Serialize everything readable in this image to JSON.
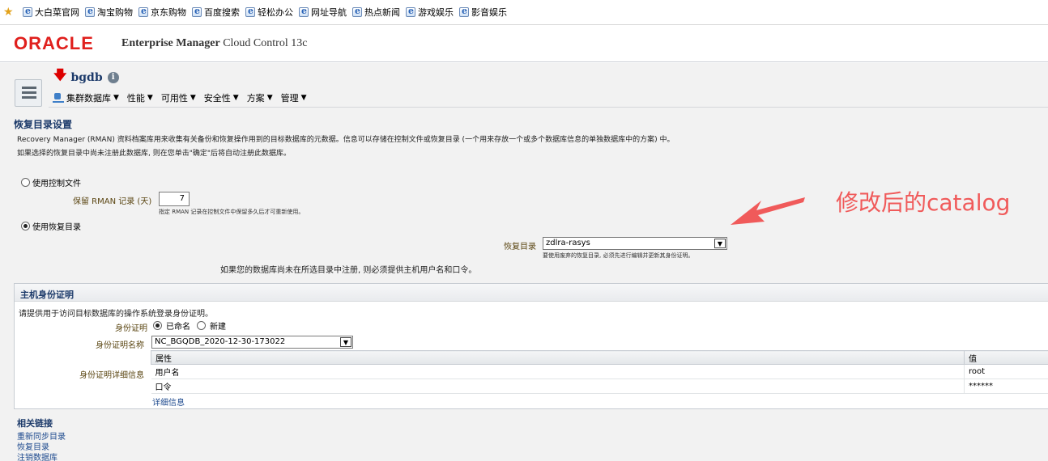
{
  "favorites": {
    "items": [
      {
        "label": "大白菜官网"
      },
      {
        "label": "淘宝购物"
      },
      {
        "label": "京东购物"
      },
      {
        "label": "百度搜索"
      },
      {
        "label": "轻松办公"
      },
      {
        "label": "网址导航"
      },
      {
        "label": "热点新闻"
      },
      {
        "label": "游戏娱乐"
      },
      {
        "label": "影音娱乐"
      }
    ]
  },
  "header": {
    "logo": "ORACLE",
    "product_bold": "Enterprise Manager",
    "product_rest": " Cloud Control 13c"
  },
  "target": {
    "name": "bgdb",
    "info_glyph": "i",
    "menus": [
      {
        "label": "集群数据库"
      },
      {
        "label": "性能"
      },
      {
        "label": "可用性"
      },
      {
        "label": "安全性"
      },
      {
        "label": "方案"
      },
      {
        "label": "管理"
      }
    ]
  },
  "recovery": {
    "title": "恢复目录设置",
    "description": "Recovery Manager (RMAN) 资料档案库用来收集有关备份和恢复操作用到的目标数据库的元数据。信息可以存储在控制文件或恢复目录 (一个用来存放一个或多个数据库信息的单独数据库中的方案) 中。",
    "description2": "如果选择的恢复目录中尚未注册此数据库, 则在您单击\"确定\"后将自动注册此数据库。",
    "option_control_file": "使用控制文件",
    "rman_label": "保留 RMAN 记录 (天)",
    "rman_value": "7",
    "rman_hint": "指定 RMAN 记录在控制文件中保留多久后才可重新使用。",
    "option_catalog": "使用恢复目录",
    "selected_option": "catalog",
    "catalog_label": "恢复目录",
    "catalog_value": "zdlra-rasys",
    "catalog_hint": "要使用废弃的恢复目录, 必须先进行编辑并更新其身份证明。",
    "catalog_warning": "如果您的数据库尚未在所选目录中注册, 则必须提供主机用户名和口令。"
  },
  "credentials": {
    "title": "主机身份证明",
    "description": "请提供用于访问目标数据库的操作系统登录身份证明。",
    "credential_label": "身份证明",
    "option_named": "已命名",
    "option_new": "新建",
    "name_label": "身份证明名称",
    "name_value": "NC_BGQDB_2020-12-30-173022",
    "details_label": "身份证明详细信息",
    "table": {
      "headers": [
        "属性",
        "值"
      ],
      "rows": [
        {
          "attr": "用户名",
          "value": "root"
        },
        {
          "attr": "口令",
          "value": "******"
        }
      ]
    },
    "details_link": "详细信息"
  },
  "related": {
    "title": "相关链接",
    "links": [
      "重新同步目录",
      "恢复目录",
      "注销数据库"
    ]
  },
  "annotation": {
    "text": "修改后的catalog",
    "color": "#f05a5a"
  }
}
